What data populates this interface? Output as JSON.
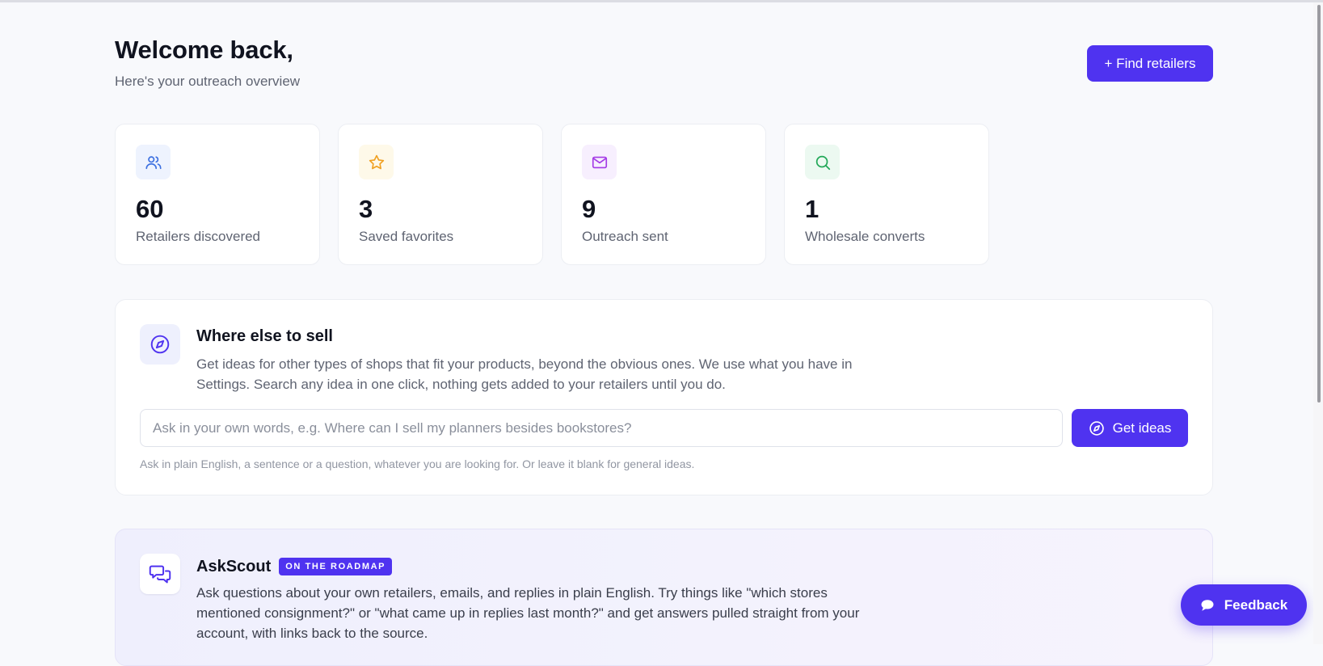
{
  "header": {
    "title": "Welcome back,",
    "subtitle": "Here's your outreach overview",
    "find_retailers_label": "+ Find retailers"
  },
  "stats": [
    {
      "icon": "users-icon",
      "value": "60",
      "label": "Retailers discovered",
      "color": "#3b6fe0",
      "bg": "#eef3fe"
    },
    {
      "icon": "star-icon",
      "value": "3",
      "label": "Saved favorites",
      "color": "#f0a020",
      "bg": "#fef9e9"
    },
    {
      "icon": "mail-icon",
      "value": "9",
      "label": "Outreach sent",
      "color": "#a43ae6",
      "bg": "#f7effe"
    },
    {
      "icon": "search-icon",
      "value": "1",
      "label": "Wholesale converts",
      "color": "#22a858",
      "bg": "#ecf9f1"
    }
  ],
  "sell": {
    "title": "Where else to sell",
    "description": "Get ideas for other types of shops that fit your products, beyond the obvious ones. We use what you have in Settings. Search any idea in one click, nothing gets added to your retailers until you do.",
    "input_value": "",
    "input_placeholder": "Ask in your own words, e.g. Where can I sell my planners besides bookstores?",
    "button_label": "Get ideas",
    "hint": "Ask in plain English, a sentence or a question, whatever you are looking for. Or leave it blank for general ideas.",
    "icon": "compass-icon"
  },
  "ask": {
    "title": "AskScout",
    "badge": "ON THE ROADMAP",
    "description": "Ask questions about your own retailers, emails, and replies in plain English. Try things like \"which stores mentioned consignment?\" or \"what came up in replies last month?\" and get answers pulled straight from your account, with links back to the source.",
    "icon": "chat-bubbles-icon"
  },
  "feedback": {
    "label": "Feedback",
    "icon": "speech-bubble-icon"
  },
  "colors": {
    "accent": "#4f33f0",
    "background": "#f8f9fc"
  }
}
